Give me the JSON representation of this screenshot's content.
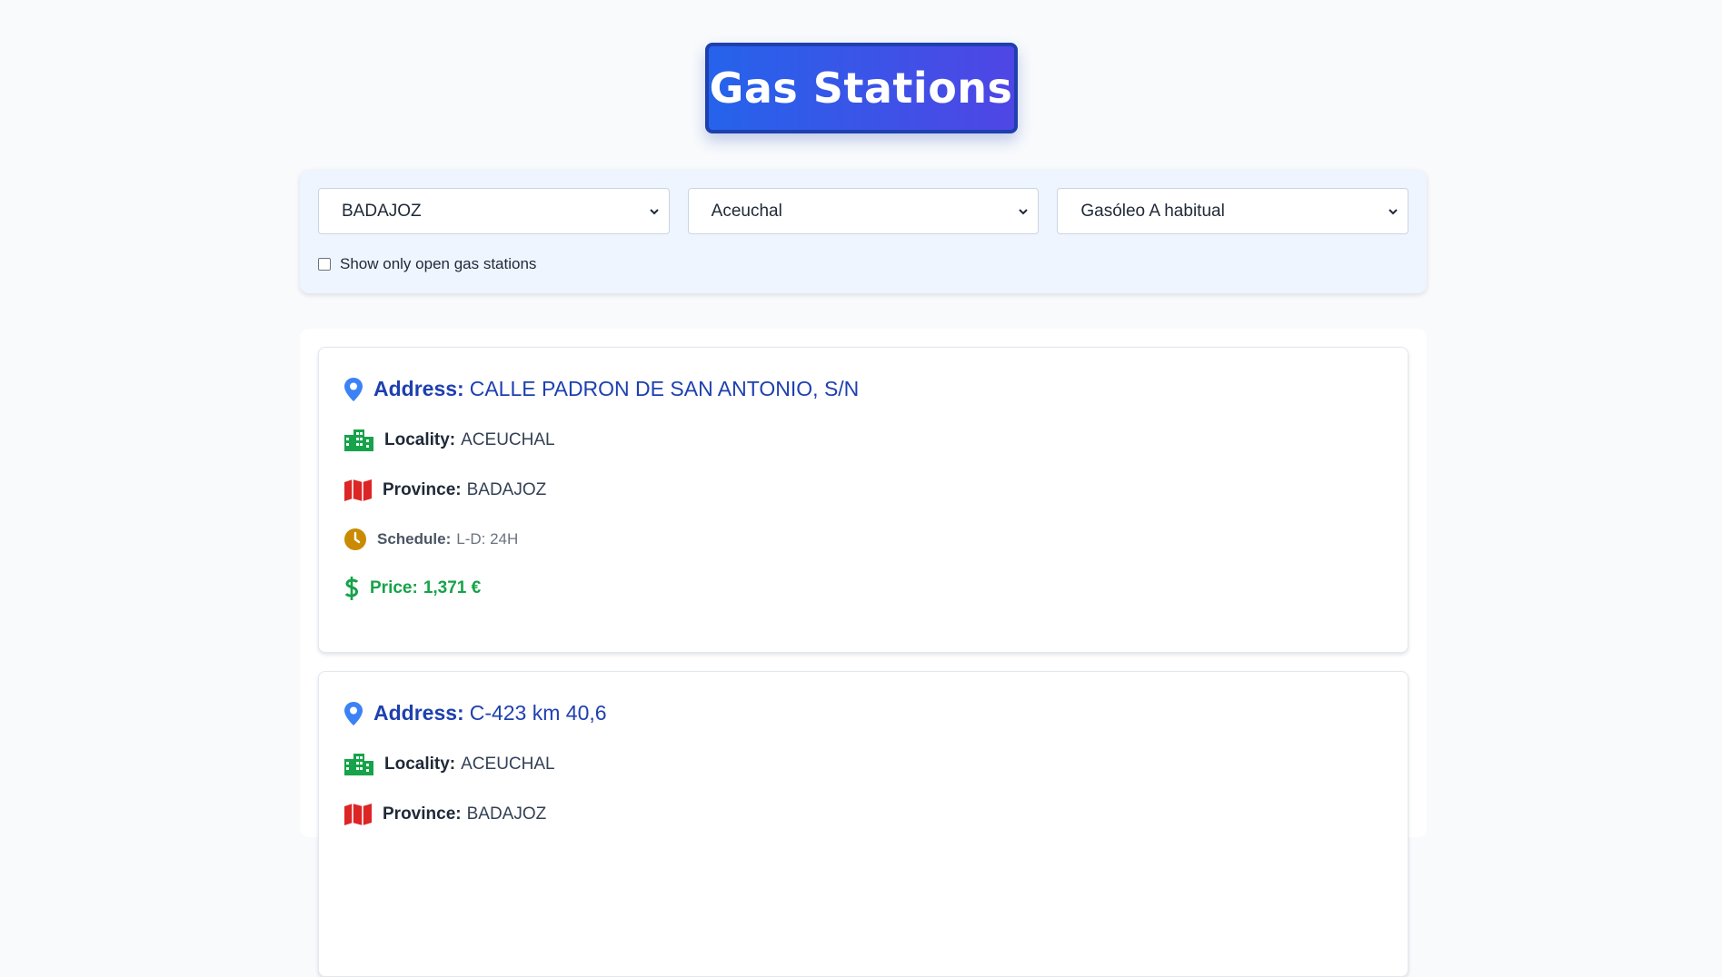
{
  "header": {
    "title": "Gas Stations"
  },
  "filters": {
    "province_select": "BADAJOZ",
    "municipality_select": "Aceuchal",
    "fuel_select": "Gasóleo A habitual",
    "open_only_label": "Show only open gas stations"
  },
  "labels": {
    "address": "Address:",
    "locality": "Locality:",
    "province": "Province:",
    "schedule": "Schedule:",
    "price": "Price:"
  },
  "stations": [
    {
      "address": "CALLE PADRON DE SAN ANTONIO, S/N",
      "locality": "ACEUCHAL",
      "province": "BADAJOZ",
      "schedule": "L-D: 24H",
      "price": "1,371 €"
    },
    {
      "address": "C-423 km 40,6",
      "locality": "ACEUCHAL",
      "province": "BADAJOZ"
    }
  ],
  "colors": {
    "accent": "#2563eb",
    "address_text": "#1e40af",
    "locality_icon": "#16a34a",
    "province_icon": "#dc2626",
    "schedule_icon": "#ca8a04",
    "price_text": "#16a34a"
  },
  "icons": {
    "address": "map-pin-icon",
    "locality": "city-icon",
    "province": "map-icon",
    "schedule": "clock-icon",
    "price": "dollar-icon"
  }
}
